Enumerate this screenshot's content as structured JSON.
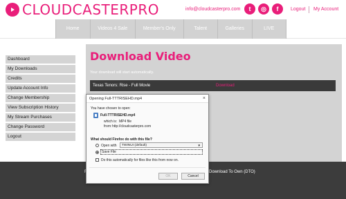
{
  "brand": {
    "name": "CLOUDCASTER",
    "suffix": "PRO",
    "accent": "#e91e7a"
  },
  "header": {
    "email": "info@cloudcasterpro.com",
    "social": [
      {
        "icon": "twitter-icon",
        "glyph": "t"
      },
      {
        "icon": "instagram-icon",
        "glyph": "◎"
      },
      {
        "icon": "facebook-icon",
        "glyph": "f"
      }
    ],
    "logout": "Logout",
    "account": "My Account"
  },
  "nav": [
    {
      "label": "Home"
    },
    {
      "label": "Videos 4 Sale"
    },
    {
      "label": "Member's Only"
    },
    {
      "label": "Talent"
    },
    {
      "label": "Galleries"
    },
    {
      "label": "LIVE"
    }
  ],
  "sidebar": [
    {
      "label": "Dashboard"
    },
    {
      "label": "My Downloads"
    },
    {
      "label": "Credits"
    },
    {
      "label": "Update Account Info"
    },
    {
      "label": "Change Membership"
    },
    {
      "label": "View Subscription History"
    },
    {
      "label": "My Stream Purchases"
    },
    {
      "label": "Change Password"
    },
    {
      "label": "Logout"
    }
  ],
  "main": {
    "title": "Download Video",
    "subtitle": "Your download will start automatically.",
    "row": {
      "title": "Texas Tenors: Rise - Full Movie",
      "link": "Download"
    }
  },
  "footer": {
    "left": "F",
    "right": "Download To Own (DTO)"
  },
  "dialog": {
    "title": "Opening Full-TTTRISEHD.mp4",
    "intro": "You have chosen to open:",
    "filename": "Full-TTTRISEHD.mp4",
    "which_is_label": "which is:",
    "which_is_value": "MP4 file",
    "from_label": "from:",
    "from_value": "http://cloudcasterpro.com",
    "question": "What should Firefox do with this file?",
    "open_with_label": "Open with",
    "open_with_value": "TWINUI (default)",
    "save_file_label": "Save File",
    "auto_label": "Do this automatically for files like this from now on.",
    "ok": "OK",
    "cancel": "Cancel",
    "close_glyph": "×"
  }
}
